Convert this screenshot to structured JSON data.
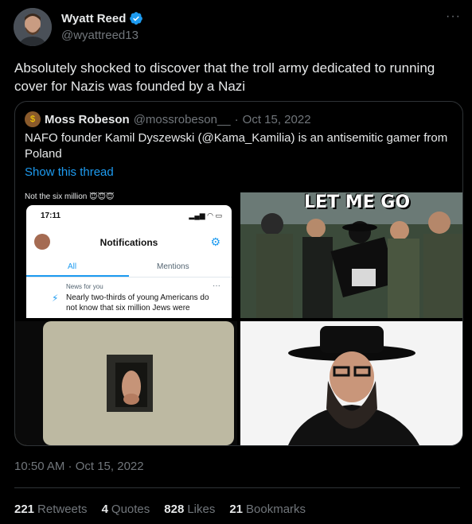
{
  "author": {
    "display_name": "Wyatt Reed",
    "handle": "@wyattreed13",
    "verified": true
  },
  "more_icon": "more-horizontal-icon",
  "text": "Absolutely shocked to discover that the troll army dedicated to running cover for Nazis was founded by a Nazi",
  "quote": {
    "display_name": "Moss Robeson",
    "handle": "@mossrobeson__",
    "separator": "·",
    "date": "Oct 15, 2022",
    "text": "NAFO founder Kamil Dyszewski (@Kama_Kamilia) is an antisemitic gamer from Poland",
    "show_thread": "Show this thread",
    "media": {
      "top_left": {
        "caption": "Not the six million 😇😇😇",
        "phone_time": "17:11",
        "phone_status": "▂▄▆ ◠ ▭",
        "title": "Notifications",
        "tab_all": "All",
        "tab_mentions": "Mentions",
        "news_label": "News for you",
        "headline": "Nearly two-thirds of young Americans do not know that six million Jews were"
      },
      "top_right": {
        "meme_text": "LET ME GO"
      }
    }
  },
  "timestamp": "10:50 AM · Oct 15, 2022",
  "stats": [
    {
      "count": "221",
      "label": "Retweets"
    },
    {
      "count": "4",
      "label": "Quotes"
    },
    {
      "count": "828",
      "label": "Likes"
    },
    {
      "count": "21",
      "label": "Bookmarks"
    }
  ],
  "colors": {
    "background": "#000000",
    "text": "#e7e9ea",
    "secondary": "#71767b",
    "link": "#1d9bf0",
    "border": "#2f3336"
  }
}
